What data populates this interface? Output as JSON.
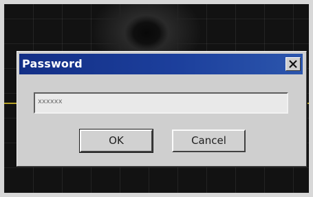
{
  "dialog": {
    "title": "Password",
    "close_icon": "close-icon",
    "password_value": "xxxxxx",
    "ok_label": "OK",
    "cancel_label": "Cancel"
  },
  "colors": {
    "titlebar": "#1c3f9c",
    "dialog_face": "#cfcfcf",
    "background": "#121212"
  }
}
